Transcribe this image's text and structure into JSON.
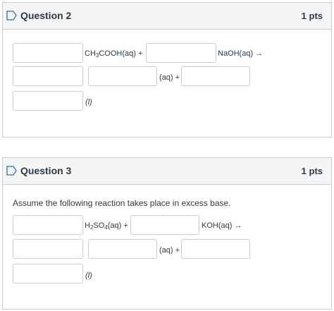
{
  "q2": {
    "title": "Question 2",
    "points": "1 pts",
    "row1": {
      "formula_main": "CH",
      "formula_sub": "3",
      "formula_rest": "COOH(aq) +",
      "after": "NaOH(aq) →"
    },
    "row2": {
      "middle": "(aq) +"
    },
    "row3": {
      "state": "(l)"
    }
  },
  "q3": {
    "title": "Question 3",
    "points": "1 pts",
    "prompt": "Assume the following reaction takes place in excess base.",
    "row1": {
      "f_a": "H",
      "f_sub1": "2",
      "f_b": "SO",
      "f_sub2": "4",
      "f_c": "(aq) +",
      "after": "KOH(aq) →"
    },
    "row2": {
      "middle": "(aq) +"
    },
    "row3": {
      "state": "(l)"
    }
  },
  "colors": {
    "accent": "#2d6fb3",
    "border": "#c7cdd1",
    "header_bg": "#f5f5f5",
    "text": "#2d3b45"
  },
  "icons": {
    "flag": "bookmark-flag-icon"
  }
}
